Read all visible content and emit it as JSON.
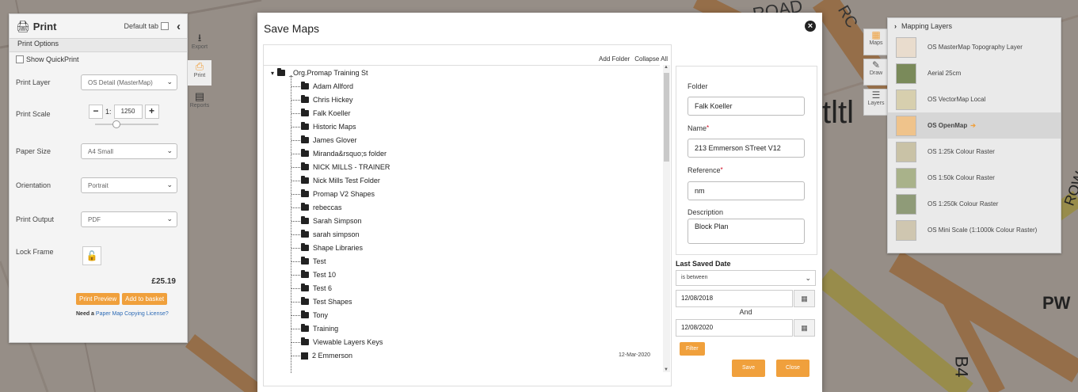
{
  "colors": {
    "accent": "#f0a03c",
    "map_bg": "#f3e6da",
    "road_orange": "#f0b277",
    "road_yellow": "#f5e27a"
  },
  "map": {
    "labels": [
      "ROAD",
      "RC",
      "PW",
      "B4",
      "ROW",
      "tltl"
    ]
  },
  "print_panel": {
    "title": "Print",
    "default_tab_label": "Default tab",
    "section_label": "Print Options",
    "quickprint_label": "Show QuickPrint",
    "print_layer_label": "Print Layer",
    "print_layer_value": "OS Detail (MasterMap)",
    "print_scale_label": "Print Scale",
    "scale_prefix": "1:",
    "scale_value": "1250",
    "paper_size_label": "Paper Size",
    "paper_size_value": "A4 Small",
    "orientation_label": "Orientation",
    "orientation_value": "Portrait",
    "print_output_label": "Print Output",
    "print_output_value": "PDF",
    "lock_frame_label": "Lock Frame",
    "price": "£25.19",
    "print_preview_label": "Print Preview",
    "add_to_basket_label": "Add to basket",
    "license_prefix": "Need a",
    "license_link": "Paper Map Copying License?"
  },
  "left_toolbar": {
    "export": "Export",
    "print": "Print",
    "reports": "Reports"
  },
  "right_toolbar": {
    "maps": "Maps",
    "draw": "Draw",
    "layers": "Layers"
  },
  "layers_panel": {
    "title": "Mapping Layers",
    "items": [
      {
        "label": "OS MasterMap Topography Layer"
      },
      {
        "label": "Aerial 25cm"
      },
      {
        "label": "OS VectorMap Local"
      },
      {
        "label": "OS OpenMap"
      },
      {
        "label": "OS 1:25k Colour Raster"
      },
      {
        "label": "OS 1:50k Colour Raster"
      },
      {
        "label": "OS 1:250k Colour Raster"
      },
      {
        "label": "OS Mini Scale (1:1000k Colour Raster)"
      }
    ]
  },
  "dialog": {
    "title": "Save Maps",
    "add_folder": "Add Folder",
    "collapse_all": "Collapse All",
    "tree_root": "_Org.Promap Training St",
    "tree_items": [
      "Adam Allford",
      "Chris Hickey",
      "Falk Koeller",
      "Historic Maps",
      "James Glover",
      "Miranda&rsquo;s folder",
      "NICK MILLS - TRAINER",
      "Nick Mills Test Folder",
      "Promap V2 Shapes",
      "rebeccas",
      "Sarah Simpson",
      "sarah simpson",
      "Shape Libraries",
      "Test",
      "Test 10",
      "Test 6",
      "Test Shapes",
      "Tony",
      "Training",
      "Viewable Layers Keys"
    ],
    "tree_file": {
      "name": "2 Emmerson",
      "date": "12-Mar-2020"
    },
    "form": {
      "folder_label": "Folder",
      "folder_value": "Falk Koeller",
      "name_label": "Name",
      "name_value": "213 Emmerson STreet V12",
      "reference_label": "Reference",
      "reference_value": "nm",
      "description_label": "Description",
      "description_value": "Block Plan"
    },
    "filter": {
      "last_saved_label": "Last Saved Date",
      "mode_value": "is between",
      "date_from": "12/08/2018",
      "and_label": "And",
      "date_to": "12/08/2020",
      "filter_button": "Filter"
    },
    "save_button": "Save",
    "close_button": "Close"
  }
}
